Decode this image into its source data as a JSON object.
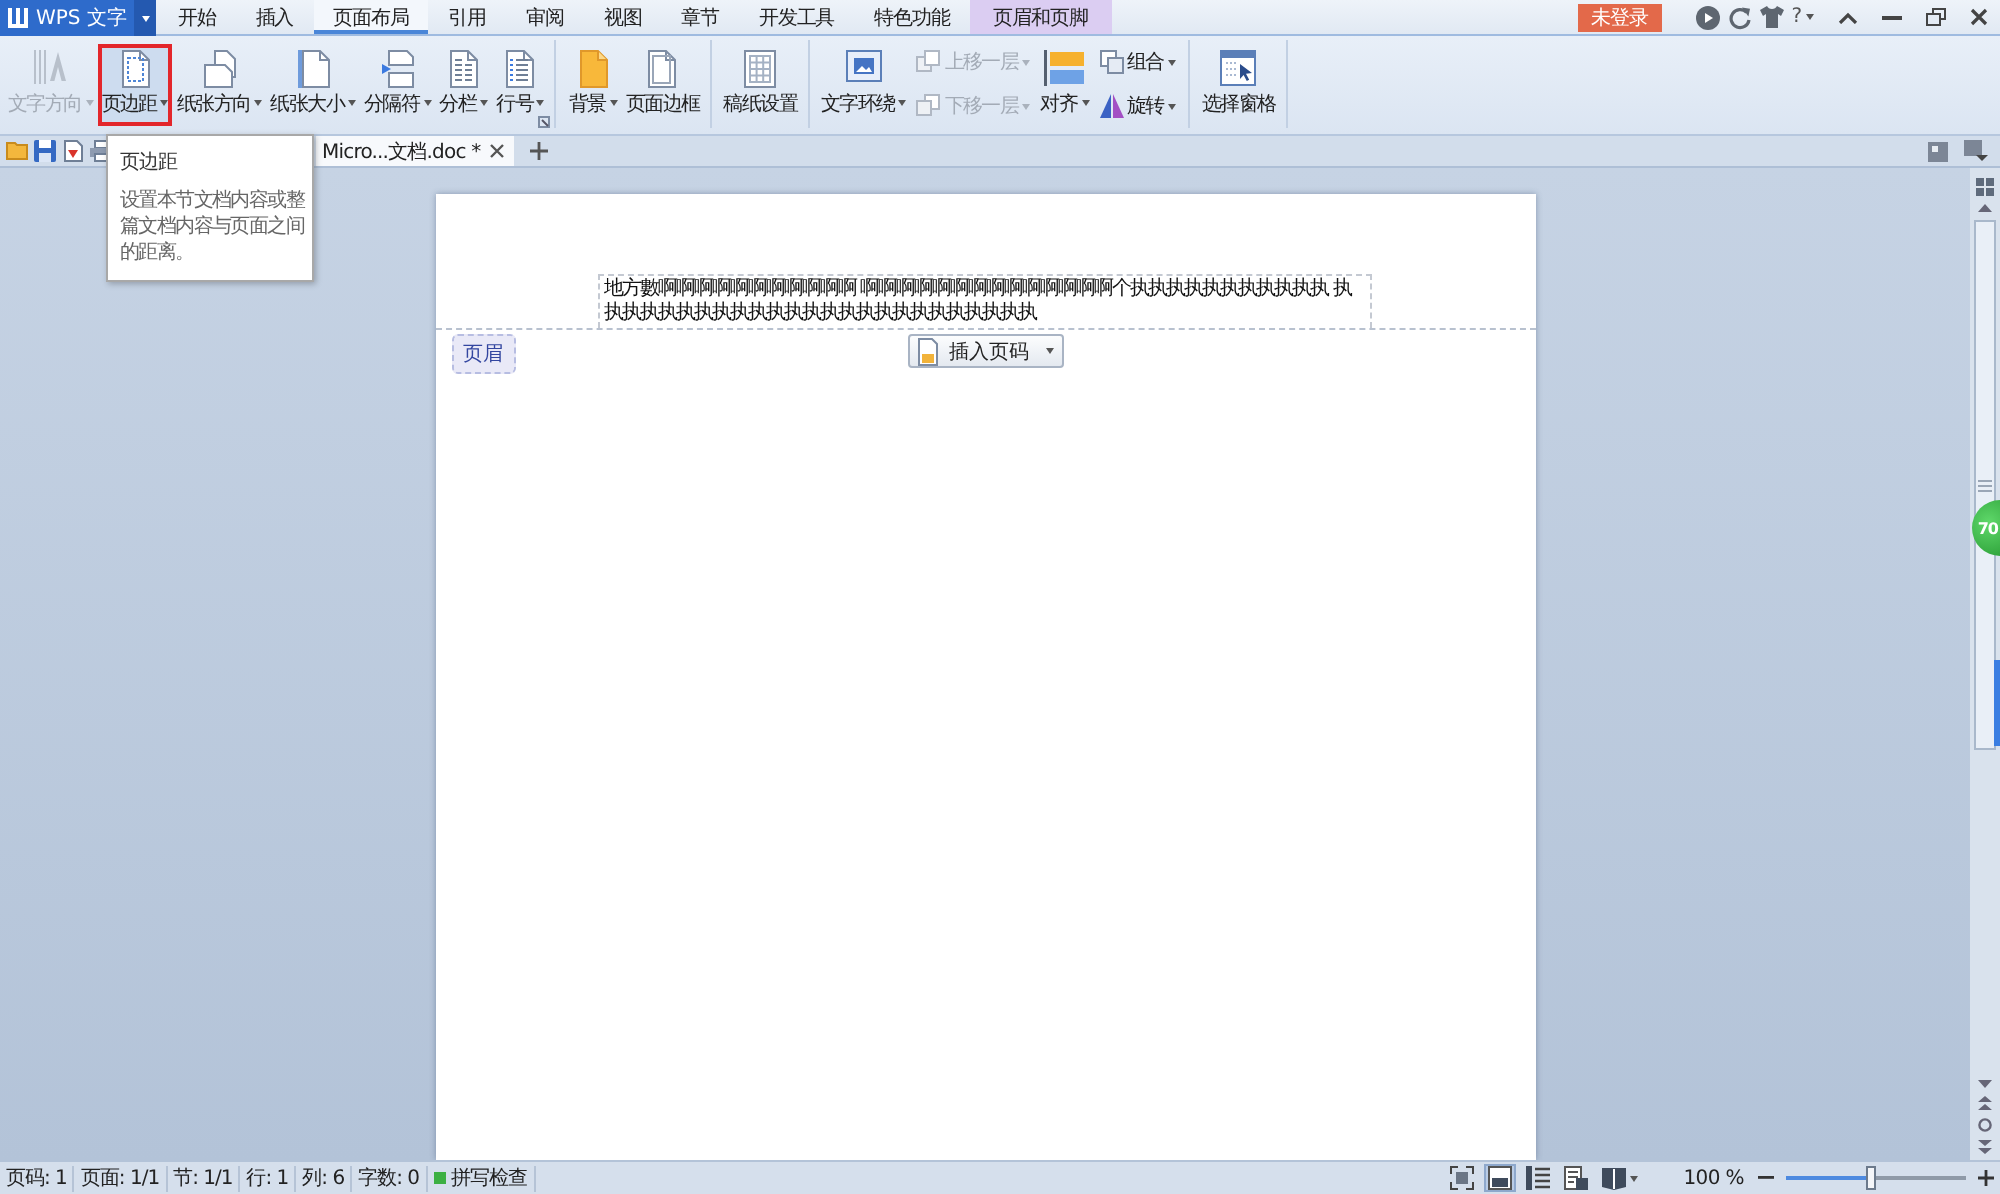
{
  "app_menu": {
    "label": "WPS 文字"
  },
  "menu_tabs": [
    {
      "label": "开始",
      "selected": false,
      "kind": "standard"
    },
    {
      "label": "插入",
      "selected": false,
      "kind": "standard"
    },
    {
      "label": "页面布局",
      "selected": true,
      "kind": "standard"
    },
    {
      "label": "引用",
      "selected": false,
      "kind": "standard"
    },
    {
      "label": "审阅",
      "selected": false,
      "kind": "standard"
    },
    {
      "label": "视图",
      "selected": false,
      "kind": "standard"
    },
    {
      "label": "章节",
      "selected": false,
      "kind": "standard"
    },
    {
      "label": "开发工具",
      "selected": false,
      "kind": "standard"
    },
    {
      "label": "特色功能",
      "selected": false,
      "kind": "standard"
    },
    {
      "label": "页眉和页脚",
      "selected": false,
      "kind": "contextual"
    }
  ],
  "login_button": {
    "label": "未登录"
  },
  "help_button": {
    "label": "?"
  },
  "ribbon": {
    "groups": [
      {
        "launcher": true,
        "columns": [
          [
            {
              "label": "文字方向",
              "kind": "large",
              "disabled": true,
              "dropdown": true,
              "highlighted": false
            }
          ],
          [
            {
              "label": "页边距",
              "kind": "large",
              "disabled": false,
              "dropdown": true,
              "highlighted": true
            }
          ],
          [
            {
              "label": "纸张方向",
              "kind": "large",
              "disabled": false,
              "dropdown": true,
              "highlighted": false
            }
          ],
          [
            {
              "label": "纸张大小",
              "kind": "large",
              "disabled": false,
              "dropdown": true,
              "highlighted": false
            }
          ],
          [
            {
              "label": "分隔符",
              "kind": "large",
              "disabled": false,
              "dropdown": true,
              "highlighted": false
            }
          ],
          [
            {
              "label": "分栏",
              "kind": "large",
              "disabled": false,
              "dropdown": true,
              "highlighted": false
            }
          ],
          [
            {
              "label": "行号",
              "kind": "large",
              "disabled": false,
              "dropdown": true,
              "highlighted": false
            }
          ]
        ]
      },
      {
        "columns": [
          [
            {
              "label": "背景",
              "kind": "large",
              "disabled": false,
              "dropdown": true,
              "highlighted": false
            }
          ],
          [
            {
              "label": "页面边框",
              "kind": "large",
              "disabled": false,
              "dropdown": false,
              "highlighted": false
            }
          ]
        ]
      },
      {
        "columns": [
          [
            {
              "label": "稿纸设置",
              "kind": "large",
              "disabled": false,
              "dropdown": false,
              "highlighted": false
            }
          ]
        ]
      },
      {
        "columns": [
          [
            {
              "label": "文字环绕",
              "kind": "large",
              "disabled": false,
              "dropdown": true,
              "highlighted": false
            }
          ],
          [
            {
              "label": "上移一层",
              "kind": "small",
              "disabled": true,
              "dropdown": true,
              "highlighted": false
            },
            {
              "label": "下移一层",
              "kind": "small",
              "disabled": true,
              "dropdown": true,
              "highlighted": false
            }
          ],
          [
            {
              "label": "对齐",
              "kind": "large",
              "disabled": false,
              "dropdown": true,
              "highlighted": false
            }
          ],
          [
            {
              "label": "组合",
              "kind": "small",
              "disabled": false,
              "dropdown": true,
              "highlighted": false
            },
            {
              "label": "旋转",
              "kind": "small",
              "disabled": false,
              "dropdown": true,
              "highlighted": false
            }
          ]
        ]
      },
      {
        "columns": [
          [
            {
              "label": "选择窗格",
              "kind": "large",
              "disabled": false,
              "dropdown": false,
              "highlighted": false
            }
          ]
        ]
      }
    ]
  },
  "document_tabs": [
    {
      "label": "Micro...文档.doc *",
      "selected": true
    }
  ],
  "tooltip": {
    "title": "页边距",
    "description": "设置本节文档内容或整篇文档内容与页面之间的距离。"
  },
  "page": {
    "header_text": "地方數啊啊啊啊啊啊啊啊啊啊啊 啊啊啊啊啊啊啊啊啊啊啊啊啊啊个执执执执执执执执执执执 执执执执执执执执执执执执执执执执执执执执执执执执执",
    "header_label": "页眉",
    "insert_page_number_button": {
      "label": "插入页码"
    }
  },
  "floating_badge": {
    "label": "70"
  },
  "status_bar": {
    "items": [
      "页码: 1",
      "页面: 1/1",
      "节: 1/1",
      "行: 1",
      "列: 6",
      "字数: 0"
    ],
    "spell_check": {
      "label": "拼写检查",
      "on": true
    },
    "view_buttons": [
      {
        "selected": false
      },
      {
        "selected": true
      },
      {
        "selected": false
      },
      {
        "selected": false
      },
      {
        "selected": false,
        "dropdown": true
      }
    ],
    "zoom": {
      "reading": "100 %",
      "level": 0.47
    }
  }
}
